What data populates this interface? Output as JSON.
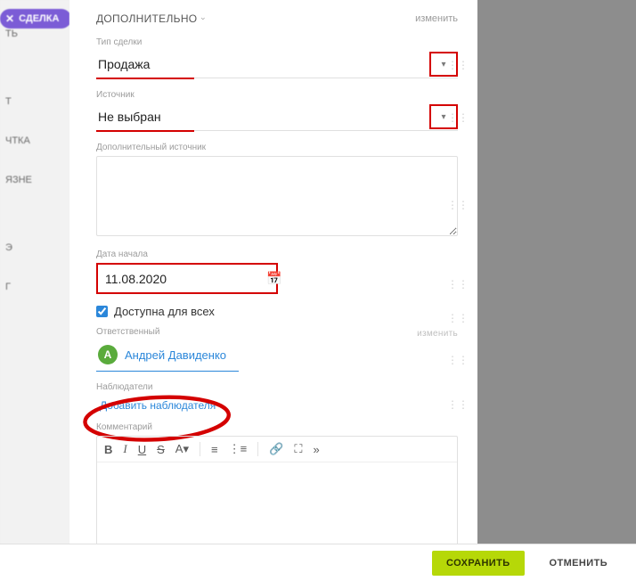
{
  "deal_chip": {
    "label": "СДЕЛКА"
  },
  "left_items": [
    "ТЬ",
    "",
    "Т",
    "ЧТКА",
    "ЯЗНЕ",
    "",
    "Э",
    "Г"
  ],
  "panel": {
    "title": "ДОПОЛНИТЕЛЬНО",
    "toggle": "изменить",
    "deal_type": {
      "label": "Тип сделки",
      "value": "Продажа"
    },
    "source": {
      "label": "Источник",
      "value": "Не выбран"
    },
    "add_source": {
      "label": "Дополнительный источник",
      "value": ""
    },
    "start_date": {
      "label": "Дата начала",
      "value": "11.08.2020"
    },
    "available_all": {
      "label": "Доступна для всех",
      "checked": true
    },
    "responsible": {
      "label": "Ответственный",
      "user_initial": "А",
      "user_name": "Андрей Давиденко",
      "change": "изменить"
    },
    "observers": {
      "label": "Наблюдатели",
      "add_text": "Добавить наблюдателя"
    },
    "comment": {
      "label": "Комментарий"
    }
  },
  "footer": {
    "save": "СОХРАНИТЬ",
    "cancel": "ОТМЕНИТЬ"
  }
}
